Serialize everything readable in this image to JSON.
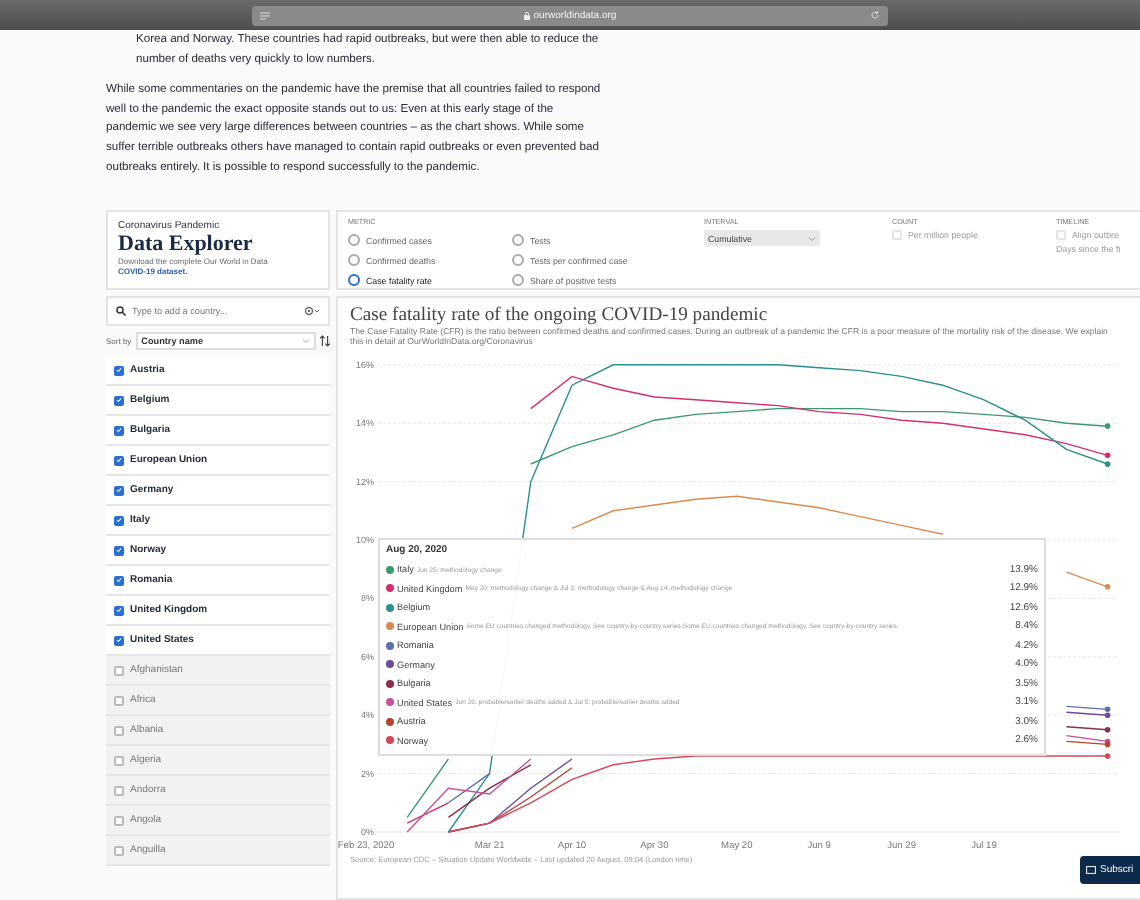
{
  "browser": {
    "url": "ourworldindata.org"
  },
  "article": {
    "paragraphs": [
      {
        "kind": "indented",
        "text": "Korea and Norway. These countries had rapid outbreaks, but were then able to reduce the number of deaths very quickly to low numbers."
      },
      {
        "kind": "plain",
        "text": "While some commentaries on the pandemic have the premise that all countries failed to respond well to the pandemic the exact opposite stands out to us: Even at this early stage of the pandemic we see very large differences between countries – as the chart shows. While some suffer terrible outbreaks others have managed to contain rapid outbreaks or even prevented bad outbreaks entirely. It is possible to respond successfully to the pandemic."
      }
    ]
  },
  "explorer": {
    "kicker": "Coronavirus Pandemic",
    "title": "Data Explorer",
    "description": "Download the complete Our World in Data",
    "link": "COVID-19 dataset."
  },
  "controls": {
    "metric": {
      "label": "METRIC",
      "options": [
        {
          "label": "Confirmed cases",
          "selected": false
        },
        {
          "label": "Confirmed deaths",
          "selected": false
        },
        {
          "label": "Case fatality rate",
          "selected": true
        },
        {
          "label": "Tests",
          "selected": false
        },
        {
          "label": "Tests per confirmed case",
          "selected": false
        },
        {
          "label": "Share of positive tests",
          "selected": false
        }
      ]
    },
    "interval": {
      "label": "INTERVAL",
      "value": "Cumulative"
    },
    "count": {
      "label": "COUNT",
      "option": {
        "label": "Per million people",
        "checked": false,
        "disabled": true
      }
    },
    "timeline": {
      "label": "TIMELINE",
      "option": {
        "label": "Align outbre",
        "checked": false,
        "disabled": true
      },
      "hint": "Days since the fi"
    }
  },
  "sidebar": {
    "search": {
      "placeholder": "Type to add a country..."
    },
    "sort": {
      "label": "Sort by",
      "value": "Country name"
    },
    "countries": [
      {
        "name": "Austria",
        "checked": true
      },
      {
        "name": "Belgium",
        "checked": true
      },
      {
        "name": "Bulgaria",
        "checked": true
      },
      {
        "name": "European Union",
        "checked": true
      },
      {
        "name": "Germany",
        "checked": true
      },
      {
        "name": "Italy",
        "checked": true
      },
      {
        "name": "Norway",
        "checked": true
      },
      {
        "name": "Romania",
        "checked": true
      },
      {
        "name": "United Kingdom",
        "checked": true
      },
      {
        "name": "United States",
        "checked": true
      },
      {
        "name": "Afghanistan",
        "checked": false
      },
      {
        "name": "Africa",
        "checked": false
      },
      {
        "name": "Albania",
        "checked": false
      },
      {
        "name": "Algeria",
        "checked": false
      },
      {
        "name": "Andorra",
        "checked": false
      },
      {
        "name": "Angola",
        "checked": false
      },
      {
        "name": "Anguilla",
        "checked": false
      }
    ]
  },
  "chart": {
    "title": "Case fatality rate of the ongoing COVID-19 pandemic",
    "subtitle": "The Case Fatality Rate (CFR) is the ratio between confirmed deaths and confirmed cases. During an outbreak of a pandemic the CFR is a poor measure of the mortality risk of the disease. We explain this in detail at OurWorldInData.org/Coronavirus",
    "chart_data": {
      "type": "line",
      "categories": [
        "Feb 23, 2020",
        null,
        null,
        "Mar 21",
        null,
        "Apr 10",
        null,
        "Apr 30",
        null,
        "May 20",
        null,
        "Jun 9",
        null,
        "Jun 29",
        null,
        "Jul 19",
        null,
        null,
        null
      ],
      "yticks": [
        {
          "value": 0,
          "label": "0%"
        },
        {
          "value": 2,
          "label": "2%"
        },
        {
          "value": 4,
          "label": "4%"
        },
        {
          "value": 6,
          "label": "6%"
        },
        {
          "value": 8,
          "label": "8%"
        },
        {
          "value": 10,
          "label": "10%"
        },
        {
          "value": 12,
          "label": "12%"
        },
        {
          "value": 14,
          "label": "14%"
        },
        {
          "value": 16,
          "label": "16%"
        }
      ],
      "ylim": [
        0,
        16
      ],
      "grid": true,
      "legend": "bottom left",
      "series": [
        {
          "name": "Italy",
          "color": "#3a9a6e",
          "values": [
            null,
            0.5,
            2.5,
            null,
            12.6,
            13.2,
            13.6,
            14.1,
            14.3,
            14.4,
            14.5,
            14.5,
            14.5,
            14.4,
            14.4,
            14.3,
            14.2,
            14.0,
            13.9
          ]
        },
        {
          "name": "United Kingdom",
          "color": "#d42e72",
          "values": [
            null,
            0.3,
            1,
            null,
            14.5,
            15.6,
            15.2,
            14.9,
            14.8,
            14.7,
            14.6,
            14.4,
            14.3,
            14.1,
            14.0,
            13.8,
            13.6,
            13.3,
            12.9
          ]
        },
        {
          "name": "Belgium",
          "color": "#2a8f90",
          "values": [
            null,
            null,
            0,
            2,
            12,
            15.3,
            16,
            16,
            16,
            16,
            16,
            15.9,
            15.8,
            15.6,
            15.3,
            14.8,
            14.1,
            13.1,
            12.6
          ]
        },
        {
          "name": "European Union",
          "color": "#d98a4e",
          "values": [
            null,
            null,
            null,
            null,
            null,
            10.4,
            11,
            11.2,
            11.4,
            11.5,
            11.3,
            11.1,
            10.8,
            10.5,
            10.2,
            null,
            null,
            8.9,
            8.4
          ]
        },
        {
          "name": "Romania",
          "color": "#5a6ea8",
          "values": [
            null,
            null,
            1,
            2,
            null,
            null,
            null,
            null,
            null,
            null,
            null,
            null,
            null,
            null,
            null,
            null,
            null,
            4.3,
            4.2
          ]
        },
        {
          "name": "Germany",
          "color": "#6b4a9c",
          "values": [
            null,
            null,
            0,
            0.3,
            1.5,
            2.5,
            null,
            null,
            null,
            null,
            null,
            null,
            null,
            null,
            null,
            null,
            null,
            4.1,
            4.0
          ]
        },
        {
          "name": "Bulgaria",
          "color": "#8a2e4c",
          "values": [
            null,
            null,
            0.5,
            1.5,
            2.3,
            null,
            null,
            null,
            null,
            null,
            null,
            null,
            null,
            null,
            null,
            null,
            null,
            3.6,
            3.5
          ]
        },
        {
          "name": "United States",
          "color": "#c7509a",
          "values": [
            null,
            0,
            1.5,
            1.3,
            2.5,
            null,
            null,
            null,
            null,
            null,
            null,
            null,
            null,
            null,
            null,
            null,
            null,
            3.3,
            3.1
          ]
        },
        {
          "name": "Austria",
          "color": "#b5442e",
          "values": [
            null,
            null,
            0,
            0.3,
            1.2,
            2.2,
            null,
            null,
            null,
            null,
            null,
            null,
            null,
            null,
            null,
            null,
            null,
            3.1,
            3.0
          ]
        },
        {
          "name": "Norway",
          "color": "#d4485a",
          "values": [
            null,
            null,
            0,
            0.3,
            1,
            1.8,
            2.3,
            2.5,
            2.6,
            2.6,
            2.6,
            2.6,
            2.6,
            2.6,
            2.6,
            2.6,
            2.6,
            2.6,
            2.6
          ]
        }
      ]
    },
    "tooltip": {
      "date": "Aug 20, 2020",
      "rows": [
        {
          "note": "Jun 25: methodology change",
          "value": "13.9%"
        },
        {
          "note": "May 20: methodology change & Jul 3: methodology change & Aug 14: methodology change",
          "value": "12.9%"
        },
        {
          "value": "12.6%"
        },
        {
          "note": "Some EU countries changed methodology. See country-by-country series.Some EU countries changed methodology. See country-by-country series.",
          "value": "8.4%"
        },
        {
          "value": "4.2%"
        },
        {
          "value": "4.0%"
        },
        {
          "value": "3.5%"
        },
        {
          "note": "Jun 26: probable/earlier deaths added & Jul 5: probable/earlier deaths added",
          "value": "3.1%"
        },
        {
          "value": "3.0%"
        },
        {
          "value": "2.6%"
        }
      ]
    },
    "source": "Source: European CDC – Situation Update Worldwide – Last updated 20 August, 09:04 (London time)"
  },
  "subscribe": {
    "label": "Subscri"
  }
}
